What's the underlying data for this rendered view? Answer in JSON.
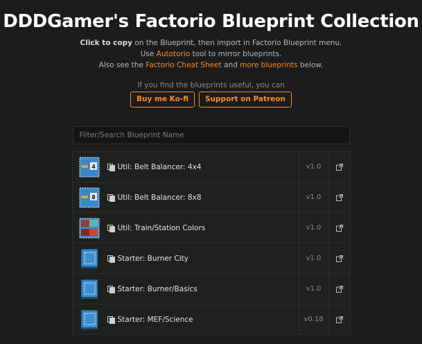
{
  "header": {
    "title": "DDDGamer's Factorio Blueprint Collection",
    "line1_bold": "Click to copy",
    "line1_rest": " on the Blueprint, then import in Factorio Blueprint menu.",
    "line2_pre": "Use ",
    "line2_link": "Autotorio",
    "line2_post": " tool to mirror blueprints.",
    "line3_pre": "Also see the ",
    "line3_link1": "Factorio Cheat Sheet",
    "line3_mid": " and ",
    "line3_link2": "more blueprints",
    "line3_post": " below."
  },
  "support": {
    "text": "If you find the blueprints useful, you can",
    "kofi_label": "Buy me Ko-fi",
    "patreon_label": "Support on Patreon"
  },
  "search": {
    "placeholder": "Filter/Search Blueprint Name",
    "value": ""
  },
  "colors": {
    "accent": "#ff8a1f",
    "background": "#1b1c1d",
    "row": "#1e211e"
  },
  "blueprints": [
    {
      "name": "Util: Belt Balancer: 4x4",
      "version": "v1.0",
      "icon": "blueprint-belt-4-icon",
      "badge": "4"
    },
    {
      "name": "Util: Belt Balancer: 8x8",
      "version": "v1.0",
      "icon": "blueprint-belt-8-icon",
      "badge": "8"
    },
    {
      "name": "Util: Train/Station Colors",
      "version": "v1.0",
      "icon": "blueprint-train-icon",
      "badge": ""
    },
    {
      "name": "Starter: Burner City",
      "version": "v1.0",
      "icon": "blueprint-book-icon",
      "badge": ""
    },
    {
      "name": "Starter: Burner/Basics",
      "version": "v1.0",
      "icon": "blueprint-book-icon",
      "badge": ""
    },
    {
      "name": "Starter: MEF/Science",
      "version": "v0.18",
      "icon": "blueprint-book-icon",
      "badge": ""
    }
  ]
}
